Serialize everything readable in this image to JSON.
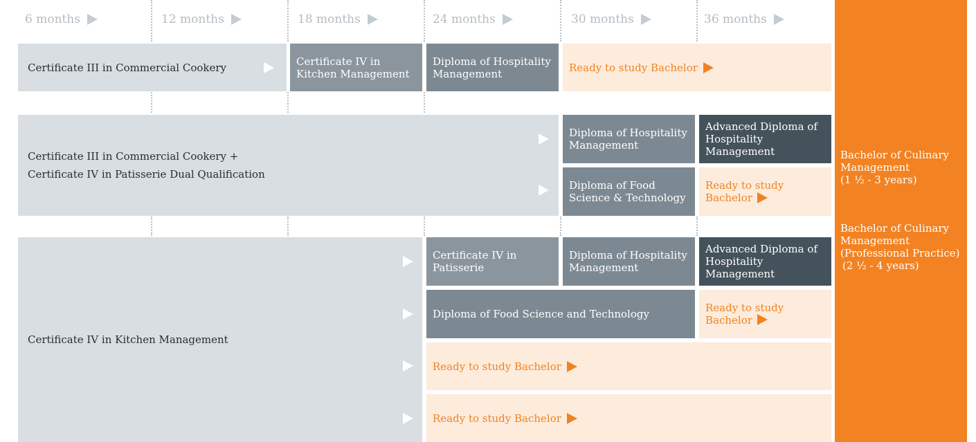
{
  "headers": [
    "6 months",
    "12 months",
    "18 months",
    "24 months",
    "30 months",
    "36 months"
  ],
  "pathway1": {
    "start": "Certificate III in Commercial Cookery",
    "step2": "Certificate IV in Kitchen Management",
    "step3": "Diploma of Hospitality Management",
    "ready": "Ready to study Bachelor"
  },
  "pathway2": {
    "start_line1": "Certificate III in Commercial Cookery +",
    "start_line2": "Certificate IV in Patisserie Dual Qualification",
    "a1": "Diploma of Hospitality Management",
    "a2": "Advanced Diploma of Hospitality Management",
    "b1": "Diploma of Food Science & Technology",
    "b2": "Ready to study Bachelor"
  },
  "pathway3": {
    "start": "Certificate IV in Kitchen Management",
    "a1": "Certificate IV in Patisserie",
    "a2": "Diploma of Hospitality Management",
    "a3": "Advanced Diploma of Hospitality Management",
    "b1": "Diploma of Food Science and Technology",
    "b2": "Ready to study Bachelor",
    "c1": "Ready to study Bachelor",
    "d1": "Ready to study Bachelor"
  },
  "outcome": {
    "bachelor1": "Bachelor of Culinary Management",
    "bachelor1_duration": "(1 ½  - 3 years)",
    "bachelor2": "Bachelor of Culinary Management (Professional Practice)",
    "bachelor2_duration": "(2 ½ - 4 years)"
  },
  "colors": {
    "accent_orange": "#f28222",
    "light_grey": "#d8dee2",
    "mid_grey": "#8b959d",
    "dark_slate": "#44525b",
    "cream": "#fdebdc"
  }
}
